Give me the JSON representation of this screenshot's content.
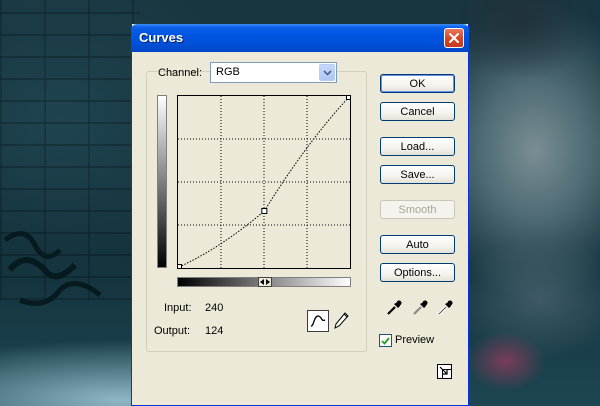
{
  "window": {
    "title": "Curves"
  },
  "channel": {
    "label": "Channel:",
    "value": "RGB"
  },
  "readout": {
    "input_label": "Input:",
    "input_value": "240",
    "output_label": "Output:",
    "output_value": "124"
  },
  "buttons": {
    "ok": "OK",
    "cancel": "Cancel",
    "load": "Load...",
    "save": "Save...",
    "smooth": "Smooth",
    "auto": "Auto",
    "options": "Options..."
  },
  "preview": {
    "label": "Preview",
    "checked": true
  },
  "curve": {
    "points": [
      [
        0,
        0
      ],
      [
        128,
        84
      ],
      [
        255,
        255
      ]
    ]
  },
  "colors": {
    "title_bar": "#0054e3",
    "dialog_bg": "#ece9d8",
    "close_button": "#d7472a"
  },
  "icons": {
    "close": "close-x-icon",
    "dropdown": "chevron-down-icon",
    "curve_tool": "curve-tool-icon",
    "pencil_tool": "pencil-icon",
    "black_eyedropper": "eyedropper-black-icon",
    "gray_eyedropper": "eyedropper-gray-icon",
    "white_eyedropper": "eyedropper-white-icon",
    "expand": "expand-dialog-icon",
    "gradient_toggle": "gradient-toggle-icon"
  }
}
